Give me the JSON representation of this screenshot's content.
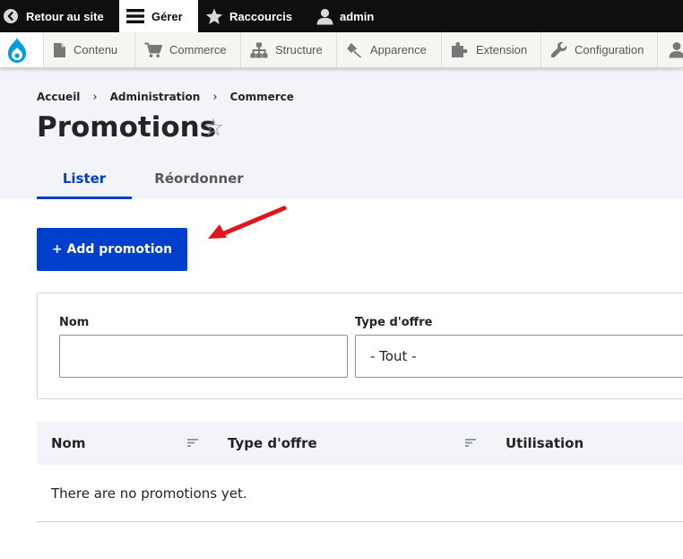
{
  "toolbar": {
    "back_label": "Retour au site",
    "manage_label": "Gérer",
    "shortcuts_label": "Raccourcis",
    "user_label": "admin"
  },
  "tray": {
    "items": [
      {
        "label": "Contenu",
        "icon": "file-icon"
      },
      {
        "label": "Commerce",
        "icon": "cart-icon"
      },
      {
        "label": "Structure",
        "icon": "sitemap-icon"
      },
      {
        "label": "Apparence",
        "icon": "brush-icon"
      },
      {
        "label": "Extension",
        "icon": "puzzle-icon"
      },
      {
        "label": "Configuration",
        "icon": "wrench-icon"
      }
    ]
  },
  "breadcrumb": [
    "Accueil",
    "Administration",
    "Commerce"
  ],
  "page": {
    "title": "Promotions"
  },
  "tabs": [
    {
      "label": "Lister",
      "active": true
    },
    {
      "label": "Réordonner",
      "active": false
    }
  ],
  "actions": {
    "add_label": "+ Add promotion"
  },
  "filters": {
    "name_label": "Nom",
    "name_value": "",
    "type_label": "Type d'offre",
    "type_selected": "- Tout -"
  },
  "table": {
    "columns": [
      "Nom",
      "Type d'offre",
      "Utilisation"
    ],
    "empty_text": "There are no promotions yet."
  },
  "colors": {
    "toolbar": "#0f0f0f",
    "accent": "#003ecc",
    "header_bg": "#f3f4f9",
    "annotation_arrow": "#e4141b"
  }
}
